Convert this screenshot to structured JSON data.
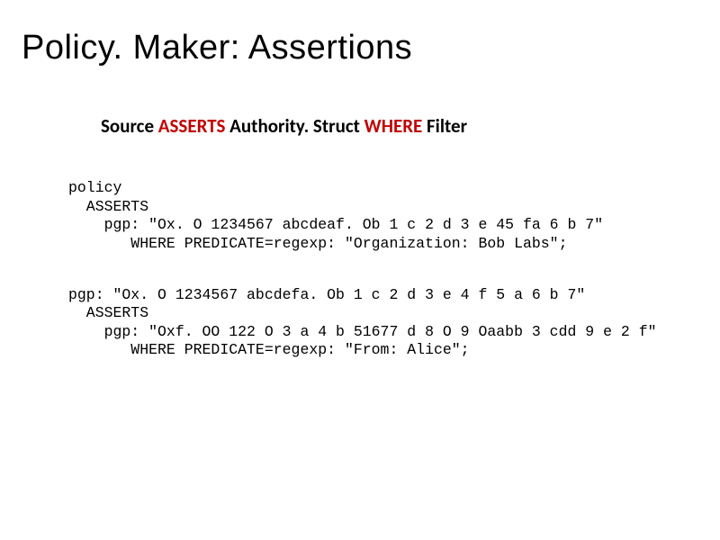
{
  "title": "Policy. Maker: Assertions",
  "syntax": {
    "p1": "Source",
    "p2": " ASSERTS ",
    "p3": "Authority. Struct",
    "p4": " WHERE ",
    "p5": "Filter"
  },
  "code1": "policy\n  ASSERTS\n    pgp: \"Ox. O 1234567 abcdeaf. Ob 1 c 2 d 3 e 45 fa 6 b 7\"\n       WHERE PREDICATE=regexp: \"Organization: Bob Labs\";",
  "code2": "pgp: \"Ox. O 1234567 abcdefa. Ob 1 c 2 d 3 e 4 f 5 a 6 b 7\"\n  ASSERTS\n    pgp: \"Oxf. OO 122 O 3 a 4 b 51677 d 8 O 9 Oaabb 3 cdd 9 e 2 f\"\n       WHERE PREDICATE=regexp: \"From: Alice\";"
}
